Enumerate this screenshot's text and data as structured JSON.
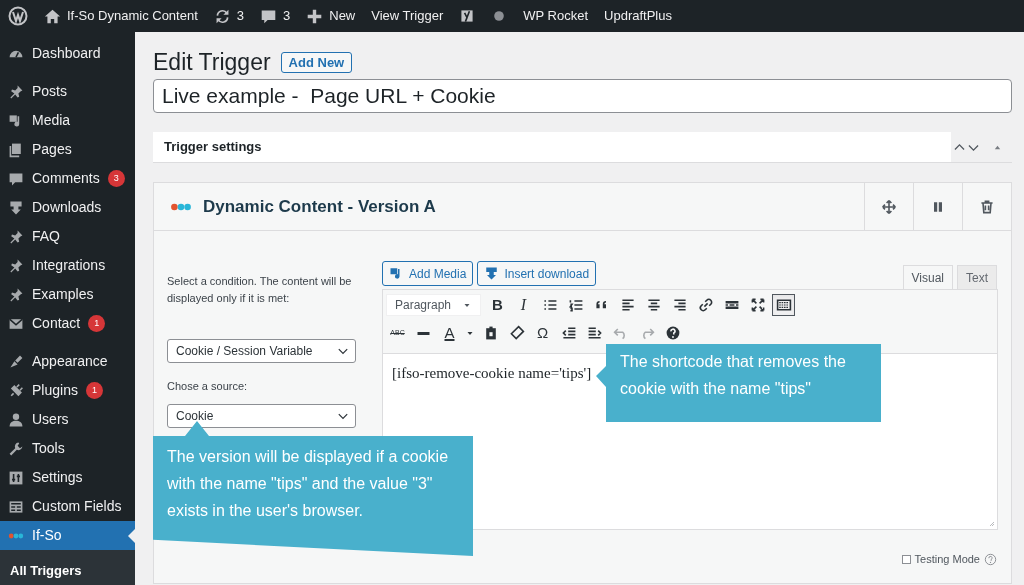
{
  "admin_bar": {
    "items": [
      {
        "kind": "wp"
      },
      {
        "kind": "home",
        "label": "If-So Dynamic Content"
      },
      {
        "kind": "updates",
        "label": "3"
      },
      {
        "kind": "comments",
        "label": "3"
      },
      {
        "kind": "new",
        "label": "New"
      },
      {
        "kind": "text",
        "label": "View Trigger"
      },
      {
        "kind": "yoast"
      },
      {
        "kind": "dot"
      },
      {
        "kind": "text",
        "label": "WP Rocket"
      },
      {
        "kind": "text",
        "label": "UpdraftPlus"
      }
    ]
  },
  "sidebar": {
    "groups": [
      [
        {
          "kind": "dashboard",
          "label": "Dashboard",
          "selected": false
        }
      ],
      [
        {
          "kind": "pin",
          "label": "Posts",
          "selected": false
        },
        {
          "kind": "media",
          "label": "Media",
          "selected": false
        },
        {
          "kind": "pages",
          "label": "Pages",
          "selected": false
        },
        {
          "kind": "comment",
          "label": "Comments",
          "badge": "3",
          "selected": false
        },
        {
          "kind": "download",
          "label": "Downloads",
          "selected": false
        },
        {
          "kind": "pin",
          "label": "FAQ",
          "selected": false
        },
        {
          "kind": "pin",
          "label": "Integrations",
          "selected": false
        },
        {
          "kind": "pin",
          "label": "Examples",
          "selected": false
        },
        {
          "kind": "mail",
          "label": "Contact",
          "badge": "1",
          "selected": false
        }
      ],
      [
        {
          "kind": "brush",
          "label": "Appearance",
          "selected": false
        },
        {
          "kind": "plug",
          "label": "Plugins",
          "badge": "1",
          "selected": false
        },
        {
          "kind": "user",
          "label": "Users",
          "selected": false
        },
        {
          "kind": "wrench",
          "label": "Tools",
          "selected": false
        },
        {
          "kind": "settings",
          "label": "Settings",
          "selected": false
        },
        {
          "kind": "grid",
          "label": "Custom Fields",
          "selected": false
        },
        {
          "kind": "ifso",
          "label": "If-So",
          "selected": true
        }
      ]
    ],
    "submenu": [
      {
        "label": "All Triggers",
        "selected": true
      }
    ]
  },
  "page": {
    "title": "Edit Trigger",
    "add_new": "Add New",
    "post_title": "Live example -  Page URL + Cookie"
  },
  "trigger_settings": {
    "title": "Trigger settings"
  },
  "version": {
    "title": "Dynamic Content - Version A",
    "condition_label": "Select a condition. The content will be displayed only if it is met:",
    "condition": "Cookie / Session Variable",
    "source_label": "Chose a source:",
    "source": "Cookie",
    "media_buttons": [
      {
        "kind": "media",
        "label": "Add Media"
      },
      {
        "kind": "download",
        "label": "Insert download"
      }
    ],
    "editor_tabs": [
      {
        "label": "Visual",
        "selected": true
      },
      {
        "label": "Text",
        "selected": false
      }
    ],
    "format": "Paragraph",
    "toolbar_rows": [
      [
        {
          "kind": "glyph",
          "text": "B",
          "selected": false
        },
        {
          "kind": "glyph",
          "text": "I",
          "selected": false
        },
        {
          "kind": "ul",
          "selected": false
        },
        {
          "kind": "ol",
          "selected": false
        },
        {
          "kind": "quote",
          "selected": false
        },
        {
          "kind": "alignleft",
          "selected": false
        },
        {
          "kind": "aligncenter",
          "selected": false
        },
        {
          "kind": "alignright",
          "selected": false
        },
        {
          "kind": "link",
          "selected": false
        },
        {
          "kind": "more",
          "selected": false
        },
        {
          "kind": "fullscreen",
          "selected": false
        },
        {
          "kind": "kitchensink",
          "selected": true
        }
      ],
      [
        {
          "kind": "glyph",
          "text": "ABC",
          "selected": false
        },
        {
          "kind": "hr",
          "selected": false
        },
        {
          "kind": "glyph",
          "text": "A",
          "selected": false
        },
        {
          "kind": "caret",
          "selected": false
        },
        {
          "kind": "paste",
          "selected": false
        },
        {
          "kind": "eraser",
          "selected": false
        },
        {
          "kind": "glyph",
          "text": "Ω",
          "selected": false
        },
        {
          "kind": "outdent",
          "selected": false
        },
        {
          "kind": "indent",
          "selected": false
        },
        {
          "kind": "undo",
          "selected": false
        },
        {
          "kind": "redo",
          "selected": false
        },
        {
          "kind": "help",
          "selected": false
        }
      ]
    ],
    "content": "[ifso-remove-cookie name='tips']",
    "testing_mode": {
      "label": "Testing Mode",
      "checked": false
    }
  },
  "callouts": [
    {
      "kind": "up",
      "text": "The version will be displayed if a cookie with the name \"tips\" and the value \"3\" exists in the user's browser."
    },
    {
      "kind": "left",
      "text": "The shortcode that removes the cookie with the name \"tips\""
    }
  ]
}
